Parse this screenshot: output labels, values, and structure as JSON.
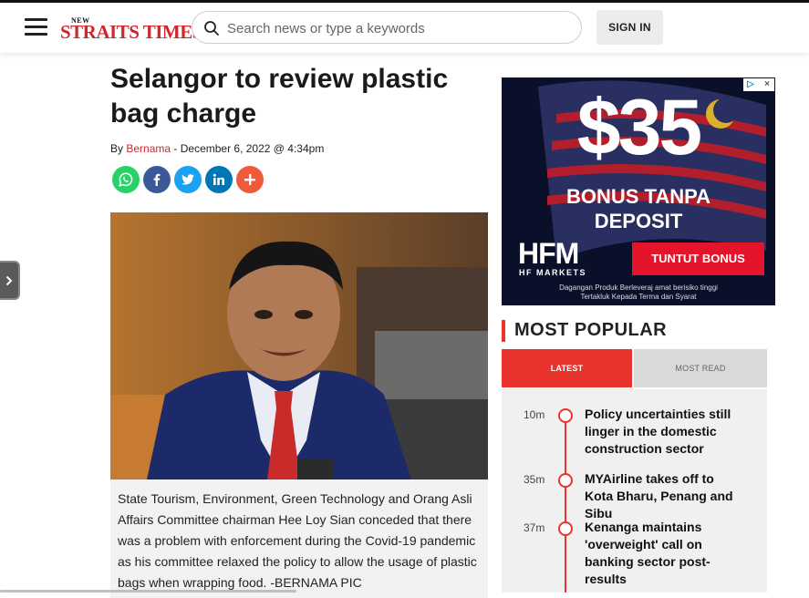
{
  "header": {
    "logo_small": "NEW",
    "logo_main": "STRAITS TIMES",
    "search_placeholder": "Search news or type a keywords",
    "signin_label": "SIGN IN"
  },
  "article": {
    "title": "Selangor to review plastic bag charge",
    "by_prefix": "By",
    "author": "Bernama",
    "date_text": " - December 6, 2022 @ 4:34pm",
    "share_icons": [
      "whatsapp-icon",
      "facebook-icon",
      "twitter-icon",
      "linkedin-icon",
      "plus-icon"
    ],
    "caption": "State Tourism, Environment, Green Technology and Orang Asli Affairs Committee chairman Hee Loy Sian conceded that there was a problem with enforcement during the Covid-19 pandemic as his committee relaxed the policy to allow the usage of plastic bags when wrapping food. -BERNAMA PIC"
  },
  "ad": {
    "amount": "$35",
    "line1": "BONUS TANPA",
    "line2": "DEPOSIT",
    "brand": "HFM",
    "brand_sub": "HF MARKETS",
    "cta": "TUNTUT BONUS",
    "disclaimer1": "Dagangan Produk Berleveraj amat berisiko tinggi",
    "disclaimer2": "Tertakluk Kepada Terma dan Syarat",
    "adchoice_label": "▷",
    "close_label": "×"
  },
  "most_popular": {
    "title": "MOST POPULAR",
    "tabs": [
      "LATEST",
      "MOST READ"
    ],
    "items": [
      {
        "time": "10m",
        "headline": "Policy uncertainties still linger in the domestic construction sector"
      },
      {
        "time": "35m",
        "headline": "MYAirline takes off to Kota Bharu, Penang and Sibu"
      },
      {
        "time": "37m",
        "headline": "Kenanga maintains 'overweight' call on banking sector post-results"
      }
    ]
  },
  "colors": {
    "brand_red": "#d3262b",
    "accent_red": "#e8342c",
    "whatsapp": "#25d366",
    "facebook": "#3b5998",
    "twitter": "#1da1f2",
    "linkedin": "#0077b5",
    "share_more": "#f05a3a"
  }
}
